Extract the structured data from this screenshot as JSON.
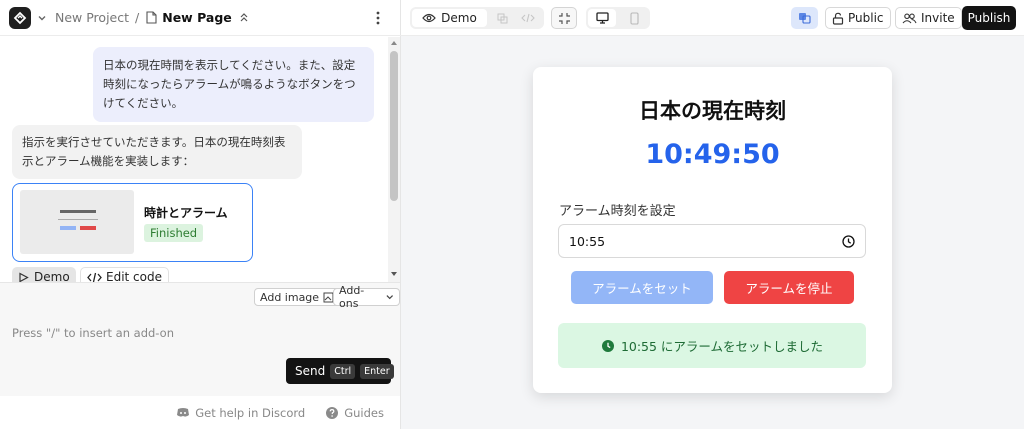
{
  "header": {
    "project": "New Project",
    "separator": "/",
    "page": "New Page"
  },
  "chat": {
    "user_message": "日本の現在時間を表示してください。また、設定時刻になったらアラームが鳴るようなボタンをつけてください。",
    "assistant_message": "指示を実行させていただきます。日本の現在時刻表示とアラーム機能を実装します：",
    "card": {
      "title": "時計とアラーム",
      "status": "Finished",
      "status_color": "#dcf3df"
    },
    "demo_label": "Demo",
    "edit_code_label": "Edit code"
  },
  "composer": {
    "add_image_label": "Add image",
    "addons_label": "Add-ons",
    "placeholder": "Press \"/\" to insert an add-on",
    "send_label": "Send",
    "kbd_ctrl": "Ctrl",
    "kbd_enter": "Enter"
  },
  "footer": {
    "discord_label": "Get help in Discord",
    "guides_label": "Guides"
  },
  "toolbar": {
    "demo_tab": "Demo",
    "public_label": "Public",
    "invite_label": "Invite",
    "publish_label": "Publish",
    "accent": "#2563eb"
  },
  "preview": {
    "title": "日本の現在時刻",
    "time": "10:49:50",
    "alarm_label": "アラーム時刻を設定",
    "alarm_value": "10:55",
    "set_button": "アラームをセット",
    "stop_button": "アラームを停止",
    "status_message": "10:55 にアラームをセットしました",
    "set_color": "#93b6f7",
    "stop_color": "#ef4444",
    "status_bg": "#dbf7e3"
  }
}
